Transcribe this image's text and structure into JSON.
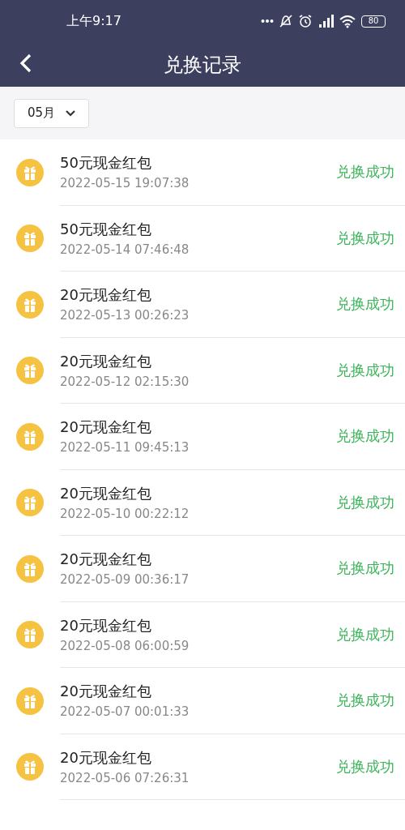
{
  "status_bar": {
    "time": "上午9:17",
    "battery": "80"
  },
  "header": {
    "title": "兑换记录"
  },
  "filter": {
    "month": "05月"
  },
  "records": [
    {
      "title": "50元现金红包",
      "time": "2022-05-15 19:07:38",
      "status": "兑换成功"
    },
    {
      "title": "50元现金红包",
      "time": "2022-05-14 07:46:48",
      "status": "兑换成功"
    },
    {
      "title": "20元现金红包",
      "time": "2022-05-13 00:26:23",
      "status": "兑换成功"
    },
    {
      "title": "20元现金红包",
      "time": "2022-05-12 02:15:30",
      "status": "兑换成功"
    },
    {
      "title": "20元现金红包",
      "time": "2022-05-11 09:45:13",
      "status": "兑换成功"
    },
    {
      "title": "20元现金红包",
      "time": "2022-05-10 00:22:12",
      "status": "兑换成功"
    },
    {
      "title": "20元现金红包",
      "time": "2022-05-09 00:36:17",
      "status": "兑换成功"
    },
    {
      "title": "20元现金红包",
      "time": "2022-05-08 06:00:59",
      "status": "兑换成功"
    },
    {
      "title": "20元现金红包",
      "time": "2022-05-07 00:01:33",
      "status": "兑换成功"
    },
    {
      "title": "20元现金红包",
      "time": "2022-05-06 07:26:31",
      "status": "兑换成功"
    }
  ]
}
